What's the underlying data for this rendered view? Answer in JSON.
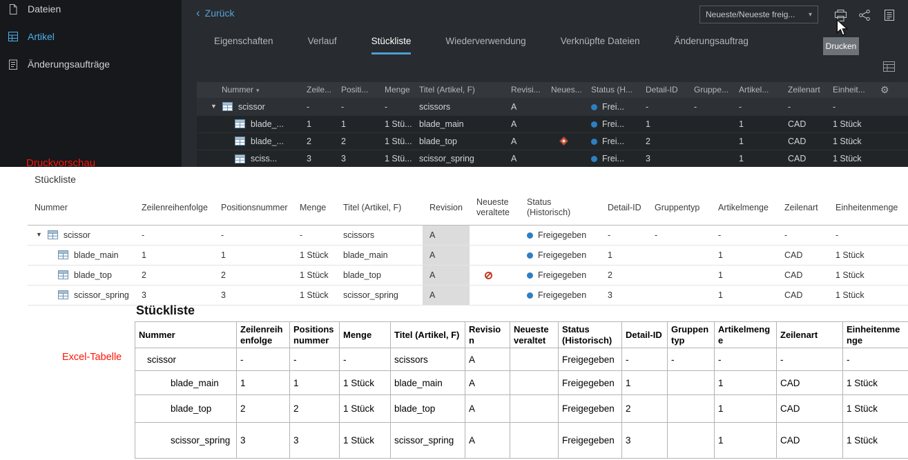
{
  "sidebar": {
    "items": [
      {
        "label": "Dateien",
        "active": false
      },
      {
        "label": "Artikel",
        "active": true
      },
      {
        "label": "Änderungsaufträge",
        "active": false
      }
    ]
  },
  "topbar": {
    "back_label": "Zurück",
    "revision_rule": "Neueste/Neueste freig...",
    "print_tooltip": "Drucken"
  },
  "tabs": [
    {
      "label": "Eigenschaften",
      "active": false
    },
    {
      "label": "Verlauf",
      "active": false
    },
    {
      "label": "Stückliste",
      "active": true
    },
    {
      "label": "Wiederverwendung",
      "active": false
    },
    {
      "label": "Verknüpfte Dateien",
      "active": false
    },
    {
      "label": "Änderungsauftrag",
      "active": false
    }
  ],
  "app_table": {
    "headers": [
      "Nummer",
      "Zeile...",
      "Positi...",
      "Menge",
      "Titel (Artikel, F)",
      "Revisi...",
      "Neues...",
      "Status (H...",
      "Detail-ID",
      "Gruppe...",
      "Artikel...",
      "Zeilenart",
      "Einheit..."
    ],
    "rows": [
      {
        "name": "scissor",
        "zeile": "-",
        "pos": "-",
        "menge": "-",
        "titel": "scissors",
        "rev": "A",
        "status": "Frei...",
        "detail": "-",
        "gruppe": "-",
        "artikel": "-",
        "zeilenart": "-",
        "einheit": "-"
      },
      {
        "name": "blade_...",
        "zeile": "1",
        "pos": "1",
        "menge": "1 Stü...",
        "titel": "blade_main",
        "rev": "A",
        "status": "Frei...",
        "detail": "1",
        "gruppe": "",
        "artikel": "1",
        "zeilenart": "CAD",
        "einheit": "1 Stück"
      },
      {
        "name": "blade_...",
        "zeile": "2",
        "pos": "2",
        "menge": "1 Stü...",
        "titel": "blade_top",
        "rev": "A",
        "status": "Frei...",
        "detail": "2",
        "gruppe": "",
        "artikel": "1",
        "zeilenart": "CAD",
        "einheit": "1 Stück"
      },
      {
        "name": "sciss...",
        "zeile": "3",
        "pos": "3",
        "menge": "1 Stü...",
        "titel": "scissor_spring",
        "rev": "A",
        "status": "Frei...",
        "detail": "3",
        "gruppe": "",
        "artikel": "1",
        "zeilenart": "CAD",
        "einheit": "1 Stück"
      }
    ]
  },
  "print_preview": {
    "title": "Stückliste",
    "headers": [
      "Nummer",
      "Zeilenreihenfolge",
      "Positionsnummer",
      "Menge",
      "Titel (Artikel, F)",
      "Revision",
      "Neueste veraltete",
      "Status (Historisch)",
      "Detail-ID",
      "Gruppentyp",
      "Artikelmenge",
      "Zeilenart",
      "Einheitenmenge"
    ],
    "rows": [
      {
        "name": "scissor",
        "zeile": "-",
        "pos": "-",
        "menge": "-",
        "titel": "scissors",
        "rev": "A",
        "status": "Freigegeben",
        "detail": "-",
        "gruppe": "-",
        "artikel": "-",
        "zeilenart": "-",
        "einheit": "-"
      },
      {
        "name": "blade_main",
        "zeile": "1",
        "pos": "1",
        "menge": "1 Stück",
        "titel": "blade_main",
        "rev": "A",
        "status": "Freigegeben",
        "detail": "1",
        "gruppe": "",
        "artikel": "1",
        "zeilenart": "CAD",
        "einheit": "1 Stück"
      },
      {
        "name": "blade_top",
        "zeile": "2",
        "pos": "2",
        "menge": "1 Stück",
        "titel": "blade_top",
        "rev": "A",
        "status": "Freigegeben",
        "detail": "2",
        "gruppe": "",
        "artikel": "1",
        "zeilenart": "CAD",
        "einheit": "1 Stück"
      },
      {
        "name": "scissor_spring",
        "zeile": "3",
        "pos": "3",
        "menge": "1 Stück",
        "titel": "scissor_spring",
        "rev": "A",
        "status": "Freigegeben",
        "detail": "3",
        "gruppe": "",
        "artikel": "1",
        "zeilenart": "CAD",
        "einheit": "1 Stück"
      }
    ]
  },
  "excel": {
    "title": "Stückliste",
    "headers": [
      "Nummer",
      "Zeilenreihenfolge",
      "Positionsnummer",
      "Menge",
      "Titel (Artikel, F)",
      "Revision",
      "Neueste veraltet",
      "Status (Historisch)",
      "Detail-ID",
      "Gruppentyp",
      "Artikelmenge",
      "Zeilenart",
      "Einheitenmenge"
    ],
    "rows": [
      {
        "name": "scissor",
        "zeile": "-",
        "pos": "-",
        "menge": "-",
        "titel": "scissors",
        "rev": "A",
        "status": "Freigegeben",
        "detail": "-",
        "gruppe": "-",
        "artikel": "-",
        "zeilenart": "-",
        "einheit": "-"
      },
      {
        "name": "blade_main",
        "zeile": "1",
        "pos": "1",
        "menge": "1 Stück",
        "titel": "blade_main",
        "rev": "A",
        "status": "Freigegeben",
        "detail": "1",
        "gruppe": "",
        "artikel": "1",
        "zeilenart": "CAD",
        "einheit": "1 Stück"
      },
      {
        "name": "blade_top",
        "zeile": "2",
        "pos": "2",
        "menge": "1 Stück",
        "titel": "blade_top",
        "rev": "A",
        "status": "Freigegeben",
        "detail": "2",
        "gruppe": "",
        "artikel": "1",
        "zeilenart": "CAD",
        "einheit": "1 Stück"
      },
      {
        "name": "scissor_spring",
        "zeile": "3",
        "pos": "3",
        "menge": "1 Stück",
        "titel": "scissor_spring",
        "rev": "A",
        "status": "Freigegeben",
        "detail": "3",
        "gruppe": "",
        "artikel": "1",
        "zeilenart": "CAD",
        "einheit": "1 Stück"
      }
    ]
  },
  "annotations": {
    "print_label": "Druckvorschau",
    "excel_label": "Excel-Tabelle"
  },
  "colors": {
    "accent_blue": "#4b9fd5",
    "status_blue": "#2e7fc1",
    "sidebar_active_blue": "#4fb0e8",
    "annotation_red": "#fe1505"
  }
}
